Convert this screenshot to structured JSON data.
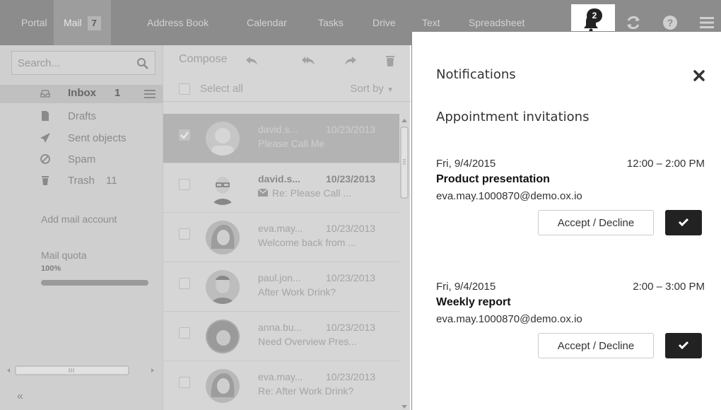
{
  "topbar": {
    "apps": [
      {
        "label": "Portal"
      },
      {
        "label": "Mail",
        "badge": "7"
      },
      {
        "label": "Address Book"
      },
      {
        "label": "Calendar"
      },
      {
        "label": "Tasks"
      },
      {
        "label": "Drive"
      },
      {
        "label": "Text"
      },
      {
        "label": "Spreadsheet"
      }
    ],
    "notification_count": "2",
    "icons": [
      "bell-icon",
      "refresh-icon",
      "help-icon",
      "menu-icon"
    ]
  },
  "sidebar": {
    "search_placeholder": "Search...",
    "folders": [
      {
        "label": "Inbox",
        "count": "1",
        "icon": "inbox-icon"
      },
      {
        "label": "Drafts",
        "count": "",
        "icon": "draft-icon"
      },
      {
        "label": "Sent objects",
        "count": "",
        "icon": "send-icon"
      },
      {
        "label": "Spam",
        "count": "",
        "icon": "spam-icon"
      },
      {
        "label": "Trash",
        "count": "11",
        "icon": "trash-icon"
      }
    ],
    "add_account": "Add mail account",
    "quota_label": "Mail quota",
    "quota_percent": "100%",
    "quota_fraction": 1.0,
    "collapse": "«"
  },
  "maillist": {
    "compose": "Compose",
    "select_all": "Select all",
    "sort_by": "Sort by",
    "mails": [
      {
        "from": "david.s...",
        "date": "10/23/2013",
        "subject": "Please Call Me",
        "selected": true,
        "unread": false
      },
      {
        "from": "david.s...",
        "date": "10/23/2013",
        "subject": "Re: Please Call ...",
        "selected": false,
        "unread": true
      },
      {
        "from": "eva.may...",
        "date": "10/23/2013",
        "subject": "Welcome back from ...",
        "selected": false,
        "unread": false
      },
      {
        "from": "paul.jon...",
        "date": "10/23/2013",
        "subject": "After Work Drink?",
        "selected": false,
        "unread": false
      },
      {
        "from": "anna.bu...",
        "date": "10/23/2013",
        "subject": "Need Overview Pres...",
        "selected": false,
        "unread": false
      },
      {
        "from": "eva.may...",
        "date": "10/23/2013",
        "subject": "Re: After Work Drink?",
        "selected": false,
        "unread": false
      }
    ]
  },
  "notifications": {
    "title": "Notifications",
    "section": "Appointment invitations",
    "items": [
      {
        "date": "Fri, 9/4/2015",
        "time": "12:00 – 2:00 PM",
        "title": "Product presentation",
        "email": "eva.may.1000870@demo.ox.io",
        "accept_label": "Accept / Decline"
      },
      {
        "date": "Fri, 9/4/2015",
        "time": "2:00 – 3:00 PM",
        "title": "Weekly report",
        "email": "eva.may.1000870@demo.ox.io",
        "accept_label": "Accept / Decline"
      }
    ]
  }
}
